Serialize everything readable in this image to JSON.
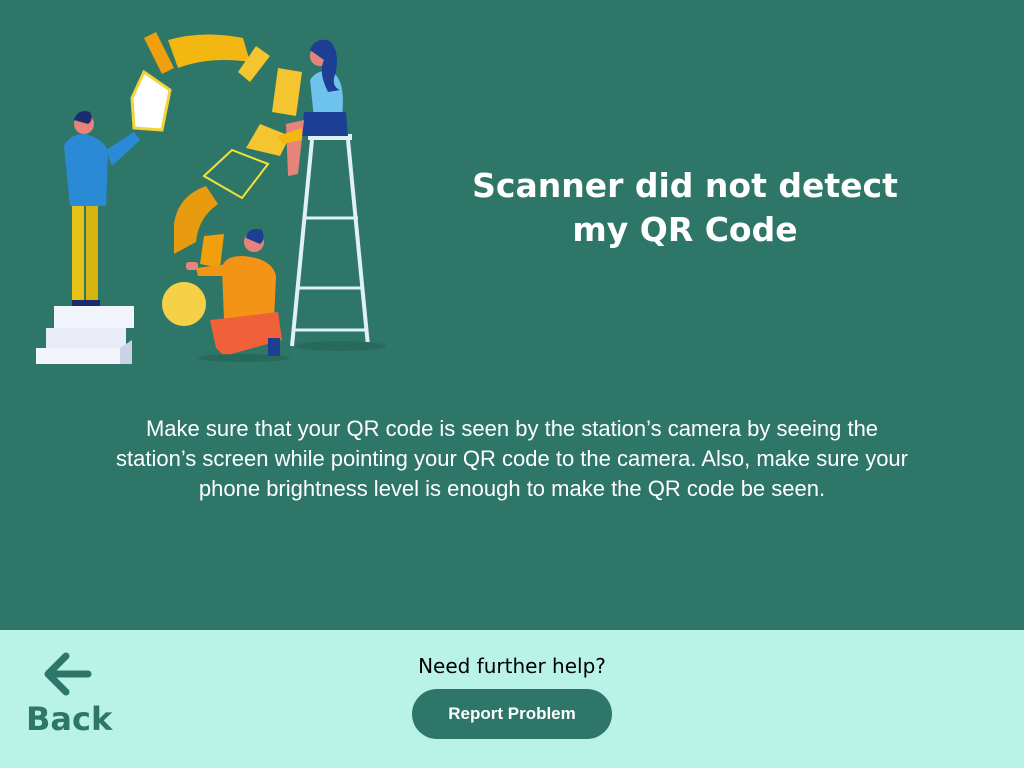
{
  "main": {
    "background_color": "#2e7768",
    "illustration_icon": "question-mark-people-illustration",
    "title_lines": [
      "Scanner did not detect",
      "my QR Code"
    ],
    "message_lines": [
      "Make sure that your QR code is seen by the station’s camera by seeing the",
      "station’s screen while pointing your QR code to the camera. Also, make sure your",
      "phone brightness level is enough to make the QR code be seen."
    ]
  },
  "footer": {
    "background_color": "#b9f3e8",
    "back": {
      "icon": "arrow-left-icon",
      "label": "Back"
    },
    "help_text": "Need further help?",
    "report_button_label": "Report Problem"
  }
}
